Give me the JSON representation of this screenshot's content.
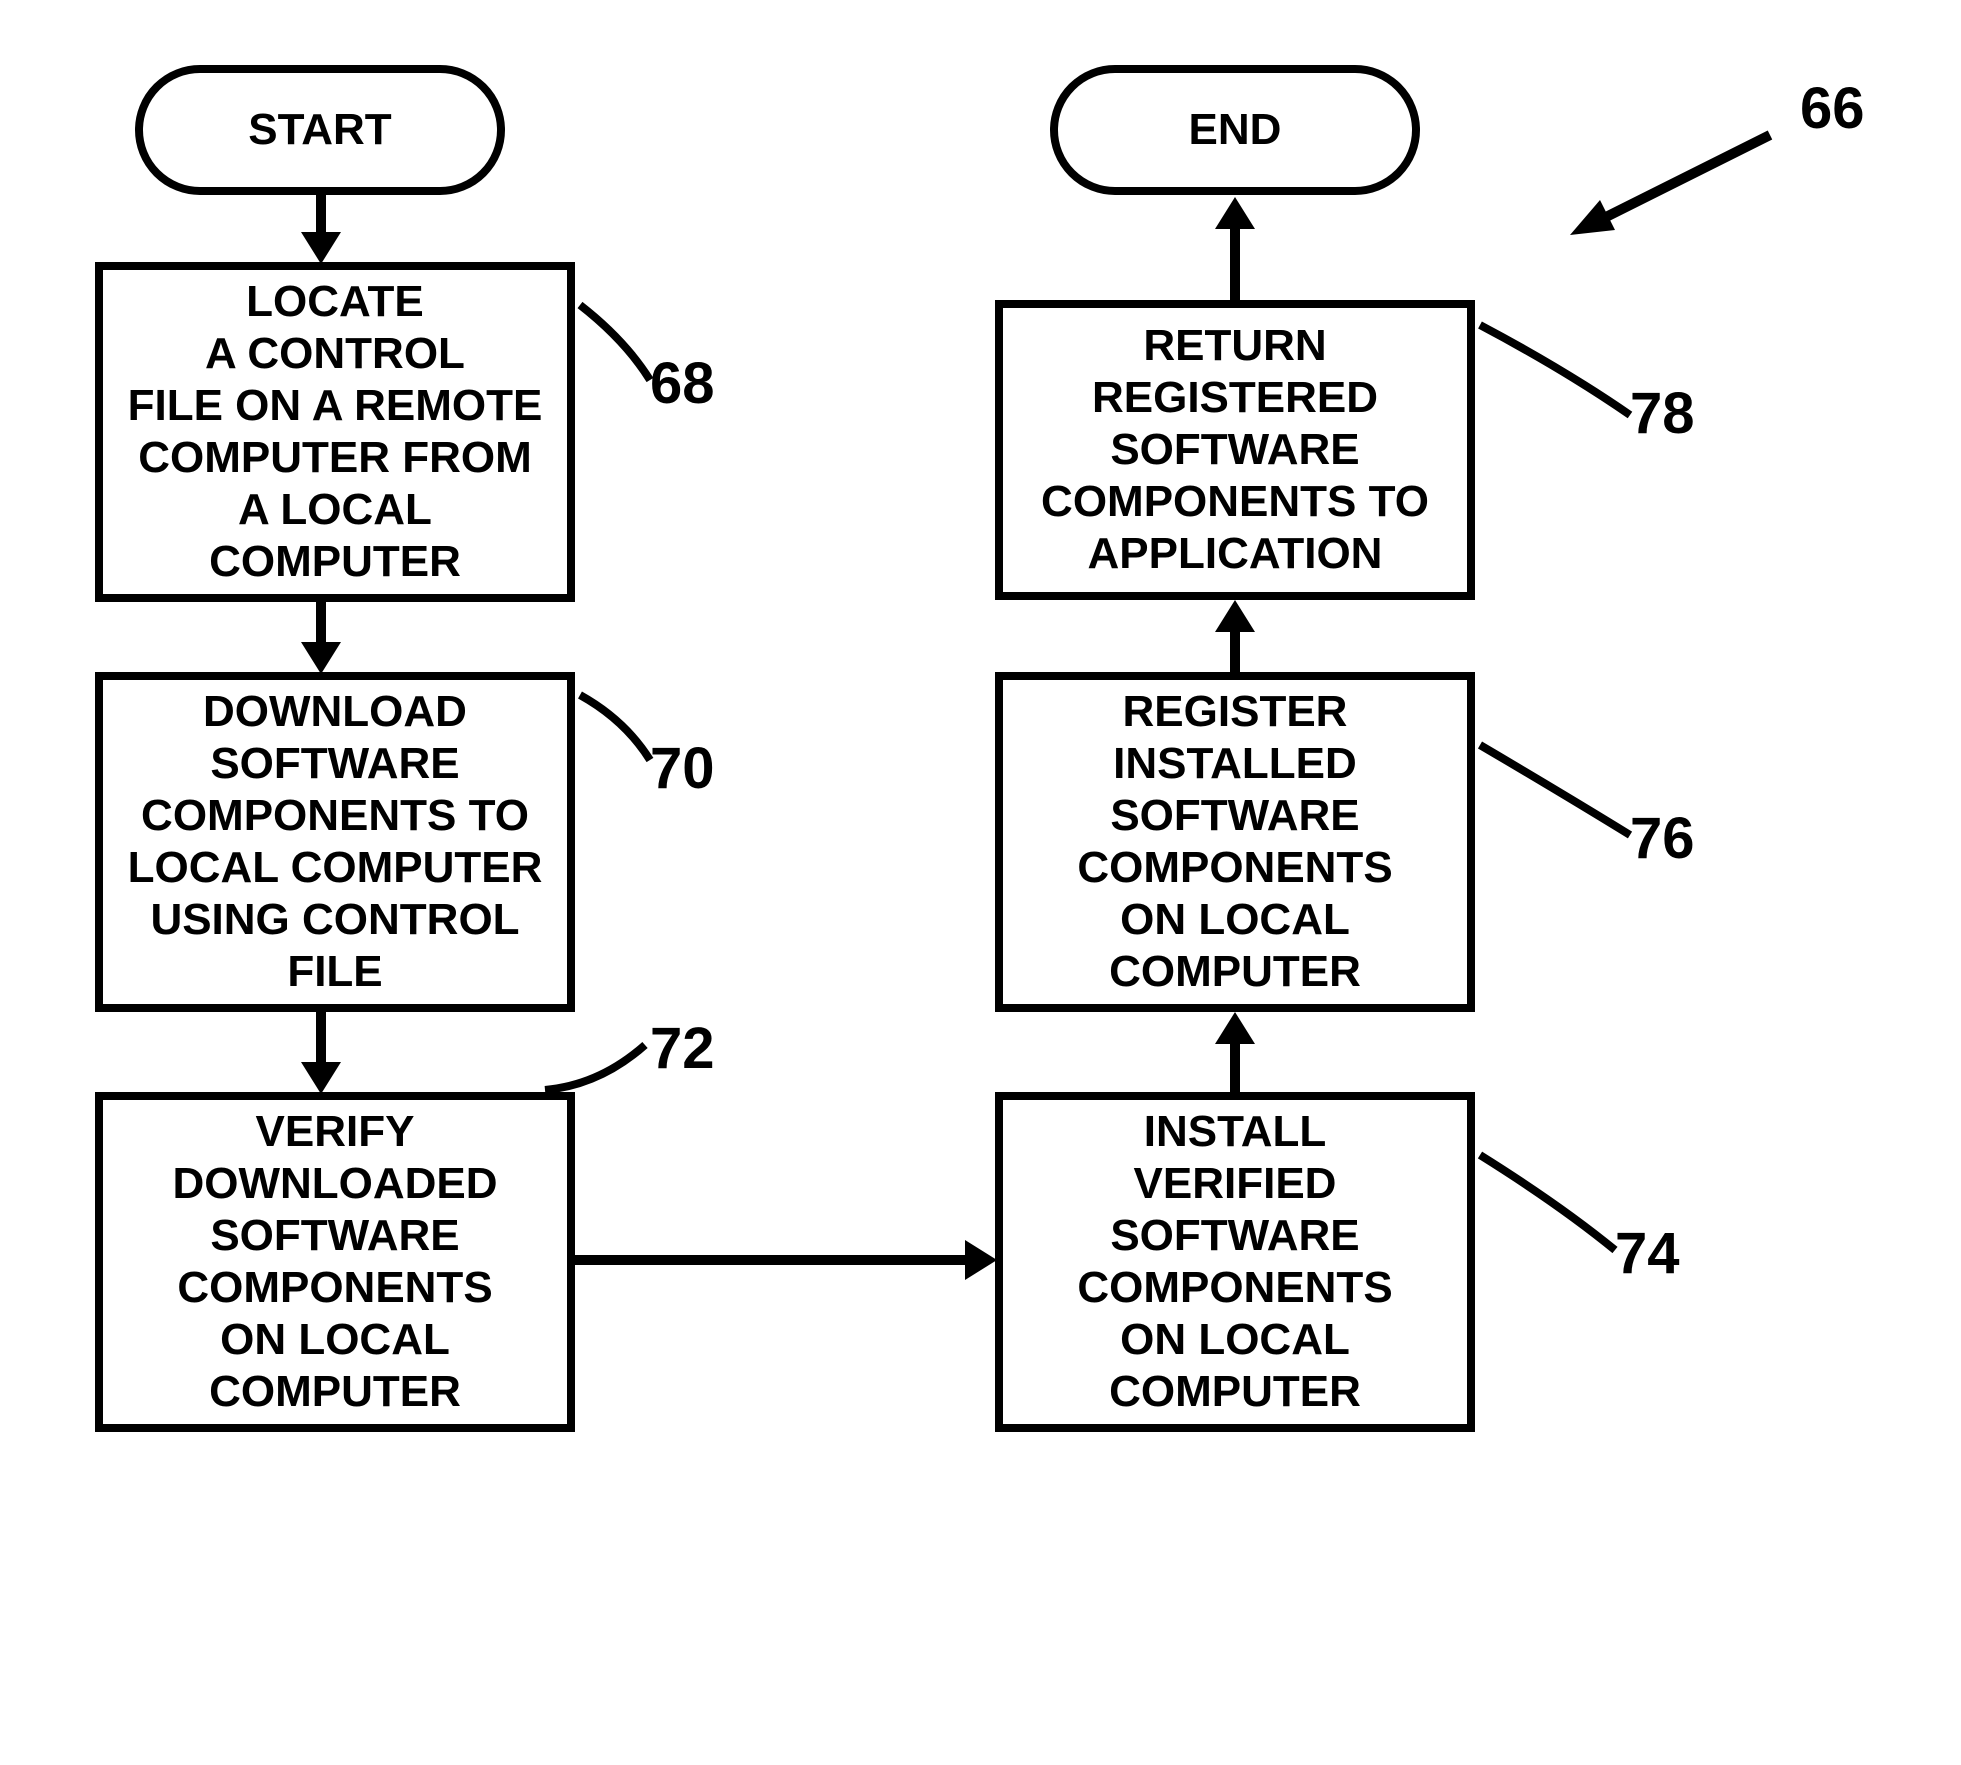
{
  "chart_data": {
    "type": "flowchart",
    "nodes": [
      {
        "id": "start",
        "kind": "terminal",
        "text": "START"
      },
      {
        "id": "68",
        "kind": "process",
        "text": "LOCATE A CONTROL FILE ON A REMOTE COMPUTER FROM A LOCAL COMPUTER"
      },
      {
        "id": "70",
        "kind": "process",
        "text": "DOWNLOAD SOFTWARE COMPONENTS TO LOCAL COMPUTER USING CONTROL FILE"
      },
      {
        "id": "72",
        "kind": "process",
        "text": "VERIFY DOWNLOADED SOFTWARE COMPONENTS ON LOCAL COMPUTER"
      },
      {
        "id": "74",
        "kind": "process",
        "text": "INSTALL VERIFIED SOFTWARE COMPONENTS ON LOCAL COMPUTER"
      },
      {
        "id": "76",
        "kind": "process",
        "text": "REGISTER INSTALLED SOFTWARE COMPONENTS ON LOCAL COMPUTER"
      },
      {
        "id": "78",
        "kind": "process",
        "text": "RETURN REGISTERED SOFTWARE COMPONENTS TO APPLICATION"
      },
      {
        "id": "end",
        "kind": "terminal",
        "text": "END"
      }
    ],
    "edges": [
      {
        "from": "start",
        "to": "68"
      },
      {
        "from": "68",
        "to": "70"
      },
      {
        "from": "70",
        "to": "72"
      },
      {
        "from": "72",
        "to": "74"
      },
      {
        "from": "74",
        "to": "76"
      },
      {
        "from": "76",
        "to": "78"
      },
      {
        "from": "78",
        "to": "end"
      }
    ]
  },
  "labels": {
    "start": "START",
    "end": "END",
    "n66": "66",
    "n68": "68",
    "n70": "70",
    "n72": "72",
    "n74": "74",
    "n76": "76",
    "n78": "78"
  },
  "boxes": {
    "b68": "LOCATE\nA CONTROL\nFILE ON A REMOTE\nCOMPUTER FROM\nA LOCAL\nCOMPUTER",
    "b70": "DOWNLOAD\nSOFTWARE\nCOMPONENTS TO\nLOCAL COMPUTER\nUSING CONTROL\nFILE",
    "b72": "VERIFY\nDOWNLOADED\nSOFTWARE\nCOMPONENTS\nON LOCAL\nCOMPUTER",
    "b74": "INSTALL\nVERIFIED\nSOFTWARE\nCOMPONENTS\nON LOCAL\nCOMPUTER",
    "b76": "REGISTER\nINSTALLED\nSOFTWARE\nCOMPONENTS\nON LOCAL\nCOMPUTER",
    "b78": "RETURN\nREGISTERED\nSOFTWARE\nCOMPONENTS TO\nAPPLICATION"
  }
}
